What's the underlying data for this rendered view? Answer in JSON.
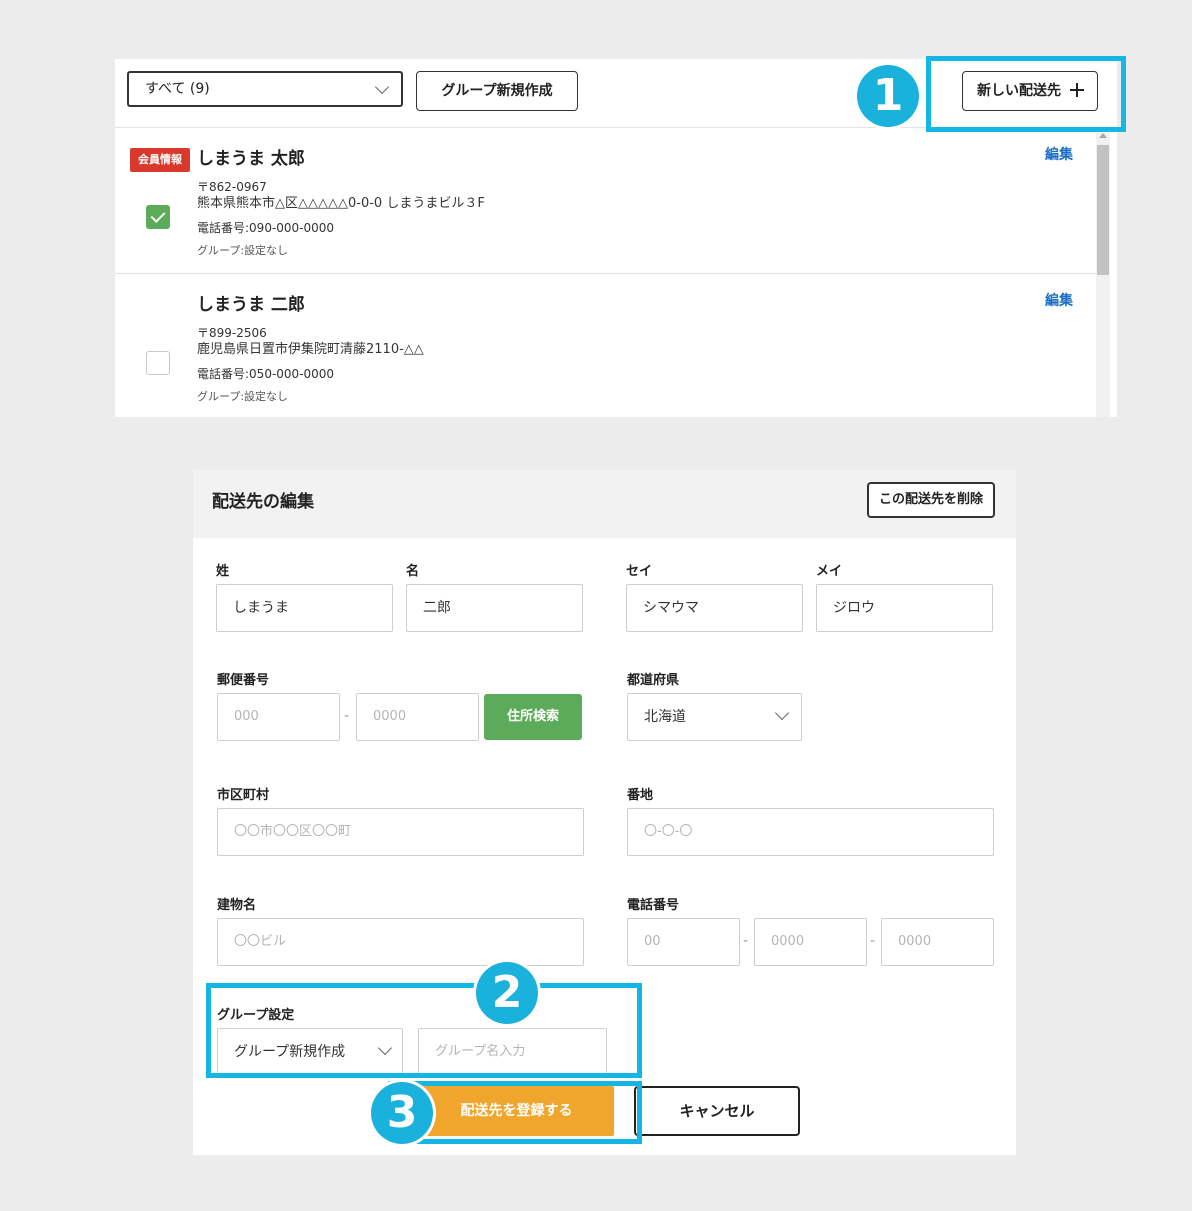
{
  "list": {
    "filter_select": "すべて (9)",
    "group_new_button": "グループ新規作成",
    "new_address_button": "新しい配送先",
    "addresses": [
      {
        "badge": "会員情報",
        "name": "しまうま 太郎",
        "zip": "〒862-0967",
        "address": "熊本県熊本市△区△△△△△0-0-0 しまうまビル３F",
        "phone": "電話番号:090-000-0000",
        "group": "グループ:設定なし",
        "edit": "編集",
        "checked": true
      },
      {
        "name": "しまうま 二郎",
        "zip": "〒899-2506",
        "address": "鹿児島県日置市伊集院町清藤2110-△△",
        "phone": "電話番号:050-000-0000",
        "group": "グループ:設定なし",
        "edit": "編集",
        "checked": false
      }
    ]
  },
  "form": {
    "title": "配送先の編集",
    "delete_button": "この配送先を削除",
    "labels": {
      "last_name": "姓",
      "first_name": "名",
      "last_kana": "セイ",
      "first_kana": "メイ",
      "postal": "郵便番号",
      "prefecture": "都道府県",
      "city": "市区町村",
      "street": "番地",
      "building": "建物名",
      "phone": "電話番号",
      "group": "グループ設定"
    },
    "values": {
      "last_name": "しまうま",
      "first_name": "二郎",
      "last_kana": "シマウマ",
      "first_kana": "ジロウ",
      "prefecture": "北海道",
      "group_select": "グループ新規作成"
    },
    "placeholders": {
      "postal1": "000",
      "postal2": "0000",
      "city": "〇〇市〇〇区〇〇町",
      "street": "〇-〇-〇",
      "building": "〇〇ビル",
      "phone1": "00",
      "phone2": "0000",
      "phone3": "0000",
      "group_name": "グループ名入力"
    },
    "separator": "-",
    "address_search_button": "住所検索",
    "submit_button": "配送先を登録する",
    "cancel_button": "キャンセル"
  },
  "callouts": [
    "1",
    "2",
    "3"
  ],
  "colors": {
    "callout": "#14b6e3",
    "badge": "#d8392b",
    "green": "#5cab5a",
    "orange": "#f0a52c",
    "link": "#1a6fc4"
  }
}
